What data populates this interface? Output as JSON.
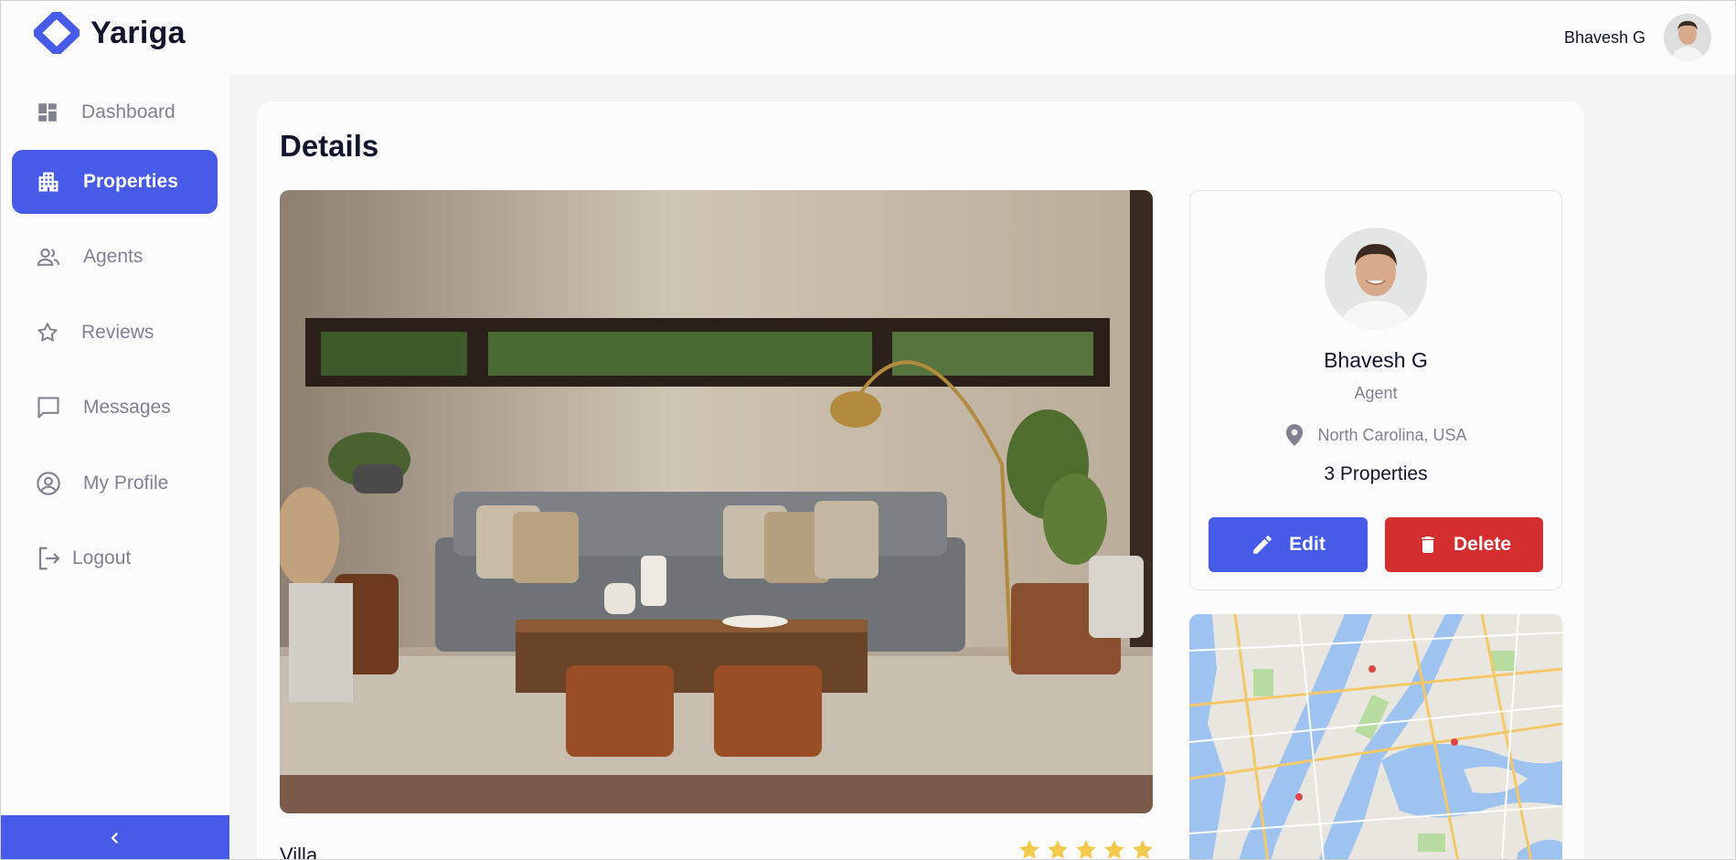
{
  "app": {
    "name": "Yariga"
  },
  "header": {
    "user_name": "Bhavesh G"
  },
  "sidebar": {
    "items": [
      {
        "label": "Dashboard",
        "icon": "dashboard-icon",
        "active": false
      },
      {
        "label": "Properties",
        "icon": "properties-icon",
        "active": true
      },
      {
        "label": "Agents",
        "icon": "agents-icon",
        "active": false
      },
      {
        "label": "Reviews",
        "icon": "star-outline-icon",
        "active": false
      },
      {
        "label": "Messages",
        "icon": "chat-bubble-icon",
        "active": false
      },
      {
        "label": "My Profile",
        "icon": "account-circle-icon",
        "active": false
      },
      {
        "label": "Logout",
        "icon": "logout-icon",
        "active": false
      }
    ],
    "collapse_icon": "chevron-left-icon"
  },
  "main": {
    "title": "Details",
    "property": {
      "type": "Villa",
      "rating": 5,
      "rating_max": 5
    }
  },
  "agent": {
    "name": "Bhavesh G",
    "role": "Agent",
    "location": "North Carolina, USA",
    "properties": "3 Properties",
    "edit_label": "Edit",
    "delete_label": "Delete"
  },
  "colors": {
    "primary": "#475be8",
    "danger": "#d42e2e",
    "text": "#11142d",
    "muted": "#808191",
    "star": "#f2c94c"
  }
}
